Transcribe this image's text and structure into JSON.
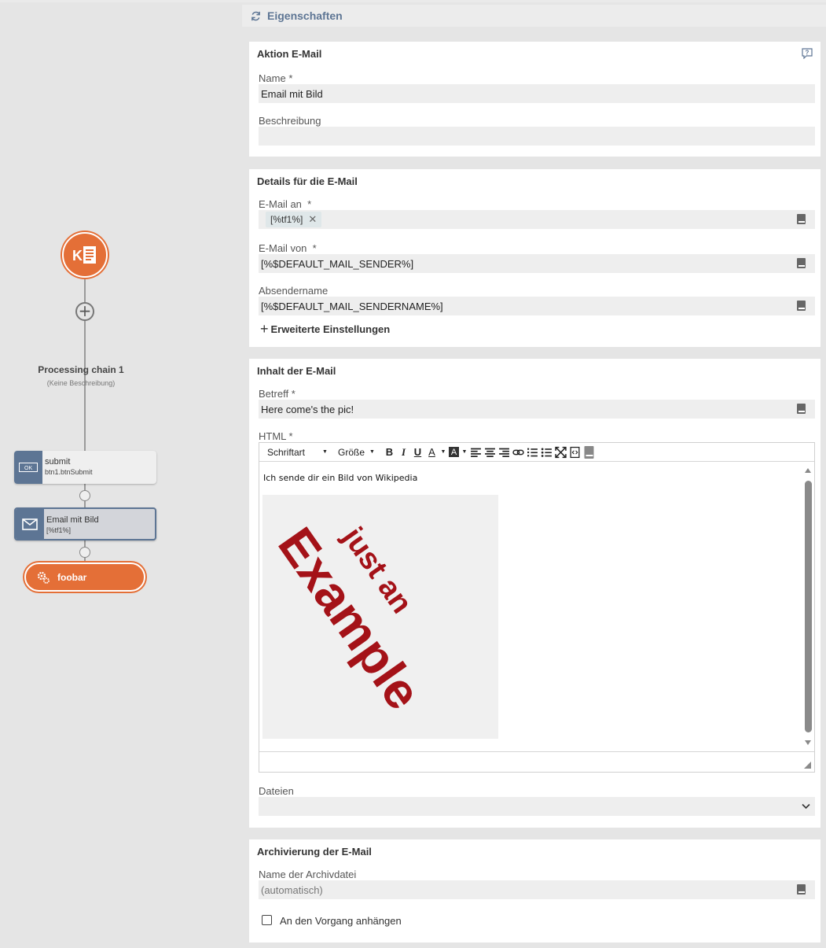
{
  "flow": {
    "chain_title": "Processing chain 1",
    "chain_description": "(Keine Beschreibung)",
    "nodes": [
      {
        "title": "submit",
        "subtitle": "btn1.btnSubmit",
        "icon": "ok-button-icon",
        "badge": "OK"
      },
      {
        "title": "Email mit Bild",
        "subtitle": "[%tf1%]",
        "icon": "envelope-icon"
      }
    ],
    "end_node": {
      "label": "foobar",
      "icon": "gears-icon"
    }
  },
  "properties": {
    "header_title": "Eigenschaften",
    "header_icon": "refresh-icon"
  },
  "aktion": {
    "title": "Aktion E-Mail",
    "name_label": "Name",
    "name_required": "*",
    "name_value": "Email mit Bild",
    "beschreibung_label": "Beschreibung",
    "beschreibung_value": ""
  },
  "details": {
    "title": "Details für die E-Mail",
    "to_label": "E-Mail an",
    "to_required": "*",
    "to_chip": "[%tf1%]",
    "from_label": "E-Mail von",
    "from_required": "*",
    "from_value": "[%$DEFAULT_MAIL_SENDER%]",
    "sender_label": "Absendername",
    "sender_value": "[%$DEFAULT_MAIL_SENDERNAME%]",
    "advanced_label": "Erweiterte Einstellungen"
  },
  "inhalt": {
    "title": "Inhalt der E-Mail",
    "subject_label": "Betreff",
    "subject_required": "*",
    "subject_value": "Here come's the pic!",
    "html_label": "HTML",
    "html_required": "*",
    "toolbar": {
      "font_label": "Schriftart",
      "size_label": "Größe"
    },
    "body_text": "Ich sende dir ein Bild von Wikipedia",
    "image_words": [
      "just an",
      "Example"
    ],
    "files_label": "Dateien",
    "files_value": ""
  },
  "archiv": {
    "title": "Archivierung der E-Mail",
    "filename_label": "Name der Archivdatei",
    "filename_placeholder": "(automatisch)",
    "attach_label": "An den Vorgang anhängen",
    "attach_checked": false
  },
  "colors": {
    "accent_orange": "#e46f37",
    "node_blue": "#5d7594",
    "header_text": "#5d7594",
    "image_red": "#a41218"
  }
}
